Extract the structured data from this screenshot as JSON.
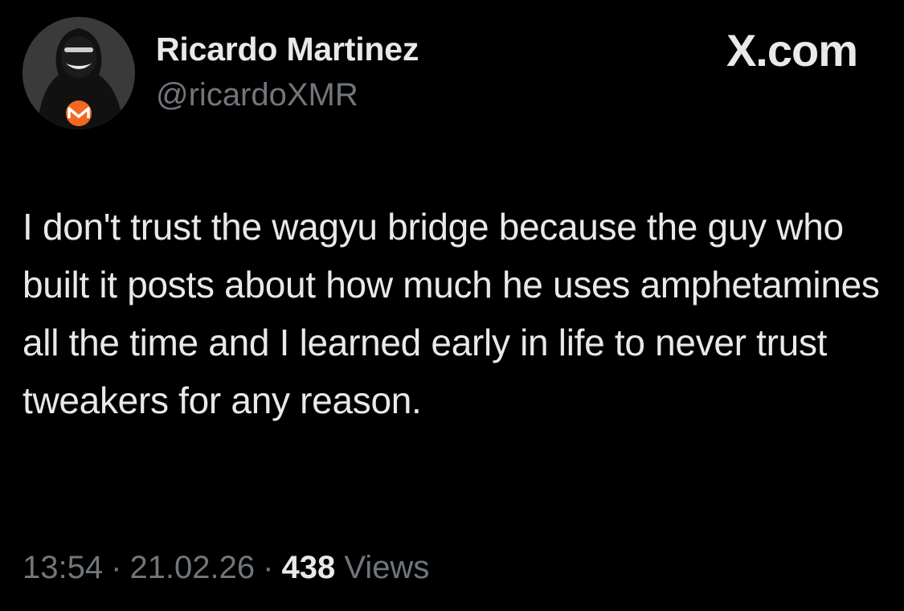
{
  "brand": "X.com",
  "author": {
    "name": "Ricardo Martinez",
    "handle": "@ricardoXMR",
    "avatar_icon": "hooded-figure-monero-avatar"
  },
  "tweet": {
    "text": "I don't trust the wagyu bridge because the guy who built it posts about how much he uses amphetamines all the time and I learned early in life to never trust tweakers for any reason."
  },
  "meta": {
    "time": "13:54",
    "date": "21.02.26",
    "separator": "·",
    "views_count": "438",
    "views_label": "Views"
  },
  "colors": {
    "background": "#000000",
    "primary_text": "#e7e9ea",
    "secondary_text": "#71767b",
    "monero_orange": "#f26822"
  }
}
